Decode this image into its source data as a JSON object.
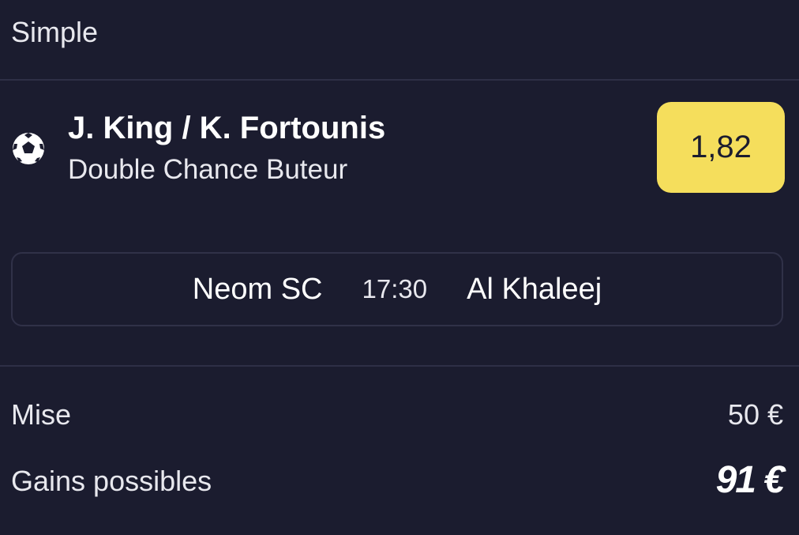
{
  "header": {
    "title": "Simple"
  },
  "selection": {
    "sport_icon": "soccer-ball-icon",
    "players": "J. King / K. Fortounis",
    "market": "Double Chance Buteur",
    "odds": "1,82",
    "odds_color": "#f5de5c"
  },
  "match": {
    "home_team": "Neom SC",
    "time": "17:30",
    "away_team": "Al Khaleej"
  },
  "summary": {
    "stake_label": "Mise",
    "stake_value": "50 €",
    "gains_label": "Gains possibles",
    "gains_value": "91 €"
  }
}
